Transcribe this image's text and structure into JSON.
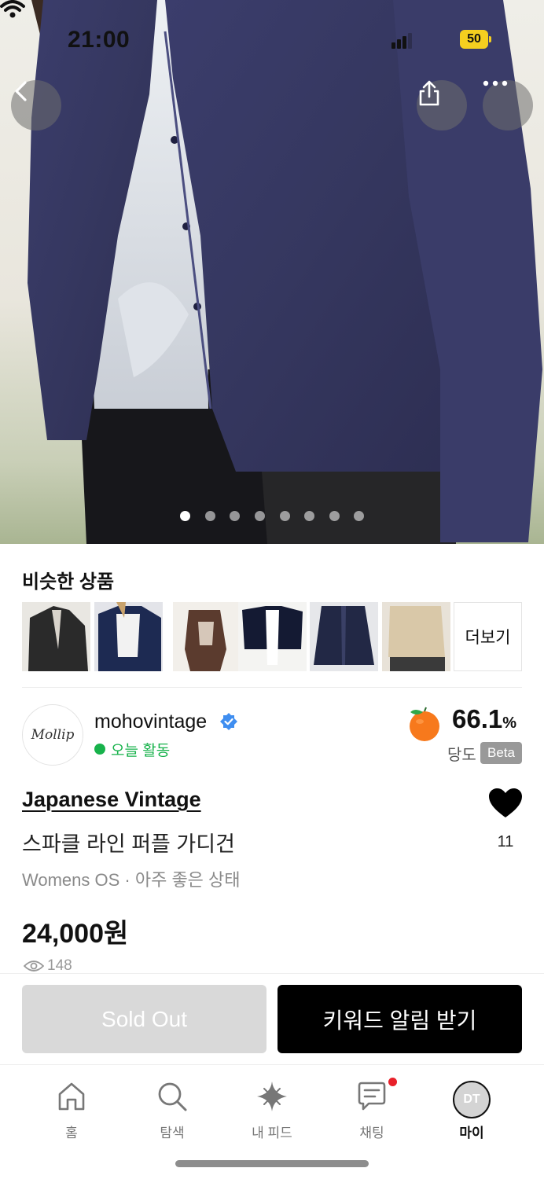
{
  "status_bar": {
    "time": "21:00",
    "battery": "50"
  },
  "hero": {
    "photo_count": 8,
    "active_index": 0,
    "icons": [
      "chevron-left-icon",
      "share-icon",
      "more-icon"
    ]
  },
  "similar": {
    "title": "비슷한 상품",
    "more_label": "더보기"
  },
  "seller": {
    "avatar_text": "Mollip",
    "name": "mohovintage",
    "activity": "오늘 활동",
    "sweetness_value": "66.1",
    "sweetness_unit": "%",
    "sweetness_label": "당도",
    "beta": "Beta"
  },
  "product": {
    "brand": "Japanese Vintage",
    "name": "스파클 라인 퍼플 가디건",
    "meta": "Womens OS · 아주 좋은 상태",
    "price": "24,000원",
    "likes": "11",
    "views": "148"
  },
  "actions": {
    "sold_out": "Sold Out",
    "keyword_alert": "키워드 알림 받기"
  },
  "tabs": [
    {
      "label": "홈"
    },
    {
      "label": "탐색"
    },
    {
      "label": "내 피드"
    },
    {
      "label": "채팅"
    },
    {
      "label": "마이",
      "avatar": "DT"
    }
  ],
  "colors": {
    "accent_green": "#17b24b",
    "verified_blue": "#3f8ef0",
    "badge_red": "#e8202a",
    "battery_yellow": "#f5cf1f"
  }
}
